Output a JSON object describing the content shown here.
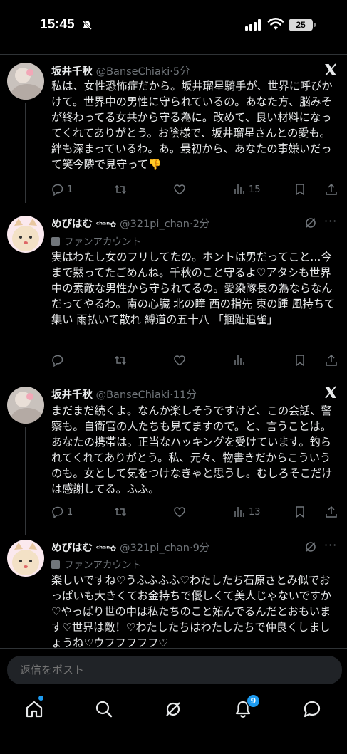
{
  "status_bar": {
    "time": "15:45",
    "battery": "25"
  },
  "tweets": [
    {
      "name": "坂井千秋",
      "handle": "@BanseChiaki",
      "time": "5分",
      "body": "私は、女性恐怖症だから。坂井瑠星騎手が、世界に呼びかけて。世界中の男性に守られているの。あなた方、脳みそが終わってる女共から守る為に。改めて、良い材料になってくれてありがとう。お陰様で、坂井瑠星さんとの愛も。絆も深まっているわ。あ。最初から、あなたの事嫌いだって笑今隣で見守って👎",
      "replies": "1",
      "views": "15"
    },
    {
      "name": "めぴはむ",
      "name_suffix": "ᶜʰᵃⁿ✿",
      "handle": "@321pi_chan",
      "time": "2分",
      "label": "ファンアカウント",
      "body": "実はわたし女のフリしてたの。ホントは男だってこと…今まで黙ってたごめんね。千秋のこと守るよ♡アタシも世界中の素敵な男性から守られてるの。愛染隊長の為ならなんだってやるわ。南の心臓 北の瞳 西の指先 東の踵 風持ちて集い 雨払いて散れ 縛道の五十八 「掴趾追雀」"
    },
    {
      "name": "坂井千秋",
      "handle": "@BanseChiaki",
      "time": "11分",
      "body": "まだまだ続くよ。なんか楽しそうですけど、この会話、警察も。自衛官の人たちも見てますので。と、言うことは。あなたの携帯は。正当なハッキングを受けています。釣られてくれてありがとう。私、元々、物書きだからこういうのも。女として気をつけなきゃと思うし。むしろそこだけは感謝してる。ふふ。",
      "replies": "1",
      "views": "13"
    },
    {
      "name": "めぴはむ",
      "name_suffix": "ᶜʰᵃⁿ✿",
      "handle": "@321pi_chan",
      "time": "9分",
      "label": "ファンアカウント",
      "body": "楽しいですね♡うふふふふ♡わたしたち石原さとみ似でおっぱいも大きくてお金持ちで優しくて美人じゃないですか♡やっぱり世の中は私たちのこと妬んでるんだとおもいます♡世界は敵！♡わたしたちはわたしたちで仲良くしましょうね♡ウフフフフフ♡"
    }
  ],
  "reply_placeholder": "返信をポスト",
  "nav": {
    "notification_badge": "9"
  },
  "colors": {
    "accent": "#1d9bf0",
    "muted": "#71767b",
    "text": "#e7e9ea",
    "background": "#000000"
  }
}
